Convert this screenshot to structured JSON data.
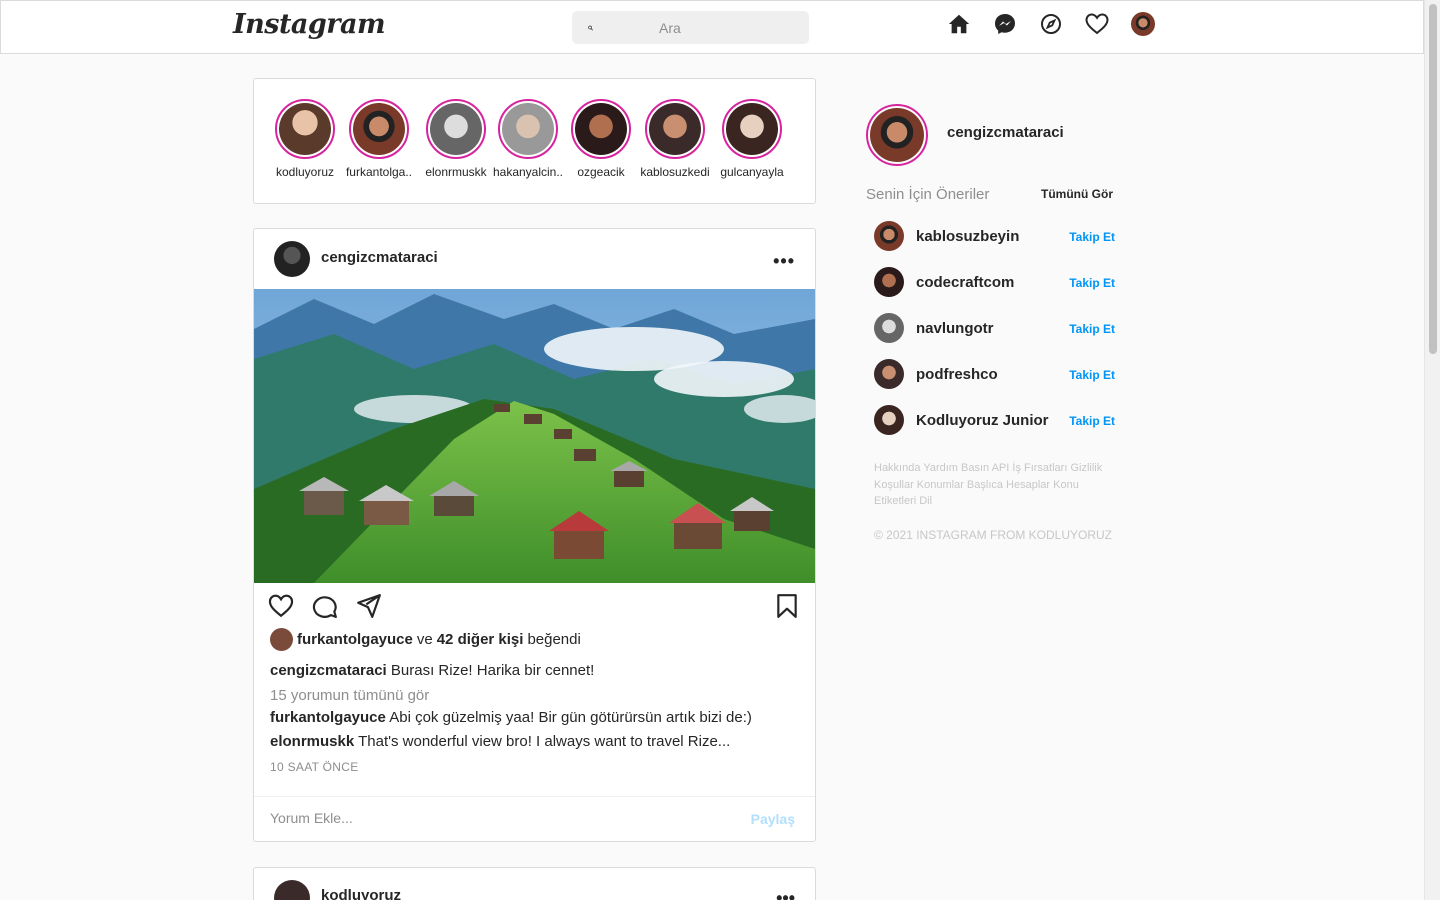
{
  "header": {
    "logo_text": "Instagram",
    "search_placeholder": "Ara"
  },
  "stories": [
    {
      "name": "kodluyoruz"
    },
    {
      "name": "furkantolga.."
    },
    {
      "name": "elonrmuskk"
    },
    {
      "name": "hakanyalcin.."
    },
    {
      "name": "ozgeacik"
    },
    {
      "name": "kablosuzkedi"
    },
    {
      "name": "gulcanyayla"
    }
  ],
  "post": {
    "username": "cengizcmataraci",
    "more": "•••",
    "likes": {
      "user": "furkantolgayuce",
      "and": "ve",
      "others": "42 diğer kişi",
      "suffix": "beğendi"
    },
    "caption": {
      "user": "cengizcmataraci",
      "text": "Burası Rize! Harika bir cennet!"
    },
    "view_all_comments": "15 yorumun tümünü gör",
    "comments": [
      {
        "user": "furkantolgayuce",
        "text": "Abi çok güzelmiş yaa! Bir gün götürürsün artık bizi de:)"
      },
      {
        "user": "elonrmuskk",
        "text": "That's wonderful view bro! I always want to travel Rize..."
      }
    ],
    "time": "10 SAAT ÖNCE",
    "comment_placeholder": "Yorum Ekle...",
    "share_label": "Paylaş"
  },
  "post2": {
    "username": "kodluyoruz",
    "more": "•••"
  },
  "sidebar": {
    "username": "cengizcmataraci",
    "suggestions_title": "Senin İçin Öneriler",
    "see_all": "Tümünü Gör",
    "suggestions": [
      {
        "name": "kablosuzbeyin",
        "action": "Takip Et"
      },
      {
        "name": "codecraftcom",
        "action": "Takip Et"
      },
      {
        "name": "navlungotr",
        "action": "Takip Et"
      },
      {
        "name": "podfreshco",
        "action": "Takip Et"
      },
      {
        "name": "Kodluyoruz Junior",
        "action": "Takip Et"
      }
    ],
    "footer_links": "Hakkında Yardım Basın API İş Fırsatları Gizlilik Koşullar Konumlar Başlıca Hesaplar Konu Etiketleri Dil",
    "copyright": "© 2021 INSTAGRAM FROM KODLUYORUZ"
  },
  "colors": {
    "accent": "#0095f6",
    "story_ring": "#d6249f",
    "share_disabled": "#b2dffc"
  },
  "icons": [
    "search-icon",
    "home-icon",
    "messenger-icon",
    "explore-icon",
    "heart-icon",
    "comment-icon",
    "share-icon",
    "bookmark-icon"
  ]
}
